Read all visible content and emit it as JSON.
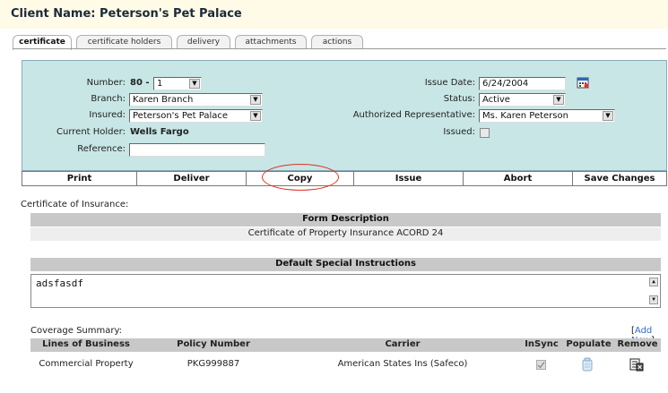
{
  "header": {
    "title": "Client Name: Peterson's Pet Palace"
  },
  "tabs": [
    {
      "label": "certificate",
      "active": true
    },
    {
      "label": "certificate holders"
    },
    {
      "label": "delivery"
    },
    {
      "label": "attachments"
    },
    {
      "label": "actions"
    }
  ],
  "form": {
    "number_label": "Number:",
    "number_prefix": "80 -",
    "number_value": "1",
    "branch_label": "Branch:",
    "branch_value": "Karen Branch",
    "insured_label": "Insured:",
    "insured_value": "Peterson's Pet Palace",
    "holder_label": "Current Holder:",
    "holder_value": "Wells Fargo",
    "reference_label": "Reference:",
    "reference_value": "",
    "issue_date_label": "Issue Date:",
    "issue_date_value": "6/24/2004",
    "status_label": "Status:",
    "status_value": "Active",
    "auth_rep_label": "Authorized Representative:",
    "auth_rep_value": "Ms. Karen Peterson",
    "issued_label": "Issued:"
  },
  "actions": [
    "Print",
    "Deliver",
    "Copy",
    "Issue",
    "Abort",
    "Save Changes"
  ],
  "certificate": {
    "section_label": "Certificate of Insurance:",
    "form_header": "Form Description",
    "form_value": "Certificate of Property Insurance ACORD 24"
  },
  "instructions": {
    "header": "Default Special Instructions",
    "text": "adsfasdf"
  },
  "coverage": {
    "section_label": "Coverage Summary:",
    "add_new": "Add New",
    "columns": [
      "Lines of Business",
      "Policy Number",
      "Carrier",
      "InSync",
      "Populate",
      "Remove"
    ],
    "rows": [
      {
        "line": "Commercial Property",
        "policy": "PKG999887",
        "carrier": "American States Ins (Safeco)"
      }
    ]
  },
  "colors": {
    "panel": "#c8e6e6",
    "title_bg": "#fffbe6",
    "highlight_oval": "#d32"
  }
}
